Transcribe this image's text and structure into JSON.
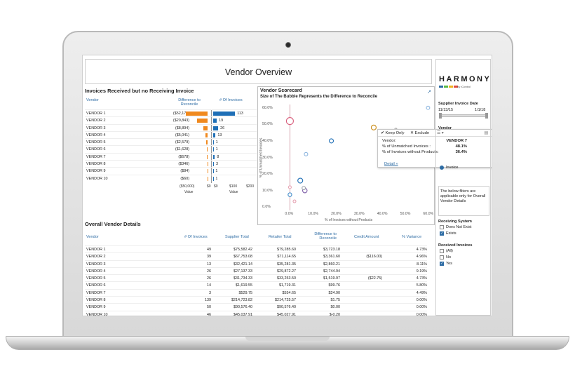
{
  "page_title": "Vendor Overview",
  "invoices": {
    "title": "Invoices Received but no Receiving Invoice",
    "col_vendor": "Vendor",
    "col_diff": "Difference to Reconcile",
    "col_count": "# Of Invoices",
    "rows": [
      {
        "vendor": "VENDOR 1",
        "diff": "($52,178)",
        "count": "113",
        "diff_frac": 0.9,
        "count_frac": 0.92
      },
      {
        "vendor": "VENDOR 2",
        "diff": "($20,843)",
        "count": "19",
        "diff_frac": 0.44,
        "count_frac": 0.15
      },
      {
        "vendor": "VENDOR 3",
        "diff": "($8,894)",
        "count": "26",
        "diff_frac": 0.18,
        "count_frac": 0.21
      },
      {
        "vendor": "VENDOR 4",
        "diff": "($5,041)",
        "count": "13",
        "diff_frac": 0.1,
        "count_frac": 0.1
      },
      {
        "vendor": "VENDOR 5",
        "diff": "($2,579)",
        "count": "1",
        "diff_frac": 0.05,
        "count_frac": 0.02
      },
      {
        "vendor": "VENDOR 6",
        "diff": "($1,628)",
        "count": "1",
        "diff_frac": 0.03,
        "count_frac": 0.02
      },
      {
        "vendor": "VENDOR 7",
        "diff": "($678)",
        "count": "8",
        "diff_frac": 0.02,
        "count_frac": 0.07
      },
      {
        "vendor": "VENDOR 8",
        "diff": "($346)",
        "count": "3",
        "diff_frac": 0.01,
        "count_frac": 0.03
      },
      {
        "vendor": "VENDOR 9",
        "diff": "($84)",
        "count": "1",
        "diff_frac": 0.005,
        "count_frac": 0.01
      },
      {
        "vendor": "VENDOR 10",
        "diff": "($60)",
        "count": "1",
        "diff_frac": 0.005,
        "count_frac": 0.01
      }
    ],
    "axis_diff_ticks": [
      "($50,000)",
      "$0"
    ],
    "axis_count_ticks": [
      "$0",
      "$100",
      "$200"
    ],
    "axis_label": "Value"
  },
  "scorecard": {
    "title": "Vendor Scorecard",
    "subtitle": "Size of The Bubble Represents the Difference to Reconcile"
  },
  "chart_data": {
    "type": "scatter",
    "title": "Vendor Scorecard",
    "subtitle": "Size of The Bubble Represents the Difference to Reconcile",
    "xlabel": "% of Invoices without Products",
    "ylabel": "% of Unmatched Invoices",
    "xlim": [
      -0.05,
      0.62
    ],
    "ylim": [
      -0.02,
      0.62
    ],
    "x_ticks": [
      "0.0%",
      "10.0%",
      "20.0%",
      "30.0%",
      "40.0%",
      "50.0%",
      "60.0%"
    ],
    "y_ticks": [
      "0.0%",
      "10.0%",
      "20.0%",
      "30.0%",
      "40.0%",
      "50.0%",
      "60.0%"
    ],
    "points": [
      {
        "x": 0.0,
        "y": 0.52,
        "size": 5,
        "color": "#d9607e"
      },
      {
        "x": 0.364,
        "y": 0.481,
        "size": 3.5,
        "color": "#c98a14"
      },
      {
        "x": 0.18,
        "y": 0.4,
        "size": 3,
        "color": "#1f6fb6"
      },
      {
        "x": 0.07,
        "y": 0.32,
        "size": 2.5,
        "color": "#8fb7e0"
      },
      {
        "x": 0.045,
        "y": 0.16,
        "size": 3.5,
        "color": "#1f6fb6"
      },
      {
        "x": 0.065,
        "y": 0.1,
        "size": 3.2,
        "color": "#7b5aa6"
      },
      {
        "x": 0.06,
        "y": 0.115,
        "size": 2.4,
        "color": "#9aa0aa"
      },
      {
        "x": 0.0,
        "y": 0.075,
        "size": 2.6,
        "color": "#3a88c8"
      },
      {
        "x": 0.0,
        "y": 0.12,
        "size": 2,
        "color": "#e7a3b3"
      },
      {
        "x": 0.02,
        "y": 0.035,
        "size": 2,
        "color": "#e7a3b3"
      },
      {
        "x": 0.6,
        "y": 0.6,
        "size": 2.4,
        "color": "#8fb7e0"
      },
      {
        "x": 0.46,
        "y": 0.47,
        "size": 1.6,
        "color": "#aaaaaa"
      }
    ]
  },
  "tooltip": {
    "keep_only": "Keep Only",
    "exclude": "Exclude",
    "vendor_label": "Vendor:",
    "vendor_value": "VENDOR 7",
    "unmatched_label": "% of Unmatched Invoices :",
    "unmatched_value": "48.1%",
    "noproducts_label": "% of Invoices without Products:",
    "noproducts_value": "36.4%",
    "detail_link": "Detail »"
  },
  "overall": {
    "title": "Overall Vendor Details",
    "columns": [
      "Vendor",
      "# Of Invoices",
      "Supplier Total",
      "Retailer Total",
      "Difference to Reconcile",
      "Credit Amount",
      "% Variance"
    ],
    "rows": [
      [
        "VENDOR 1",
        "49",
        "$75,582.42",
        "$79,285.60",
        "$3,723.18",
        "",
        "4.73%"
      ],
      [
        "VENDOR 2",
        "39",
        "$67,753.08",
        "$71,114.65",
        "$3,361.60",
        "($116.00)",
        "4.96%"
      ],
      [
        "VENDOR 3",
        "13",
        "$32,421.14",
        "$35,281.35",
        "$2,860.21",
        "",
        "8.11%"
      ],
      [
        "VENDOR 4",
        "26",
        "$27,137.33",
        "$29,872.27",
        "$2,744.94",
        "",
        "9.19%"
      ],
      [
        "VENDOR 5",
        "26",
        "$31,734.33",
        "$33,253.50",
        "$1,519.97",
        "($22.75)",
        "4.73%"
      ],
      [
        "VENDOR 6",
        "14",
        "$1,619.55",
        "$1,719.31",
        "$99.76",
        "",
        "5.80%"
      ],
      [
        "VENDOR 7",
        "3",
        "$529.75",
        "$554.65",
        "$24.90",
        "",
        "4.49%"
      ],
      [
        "VENDOR 8",
        "139",
        "$214,723.82",
        "$214,725.57",
        "$1.75",
        "",
        "0.00%"
      ],
      [
        "VENDOR 9",
        "50",
        "$90,576.40",
        "$90,576.40",
        "$0.00",
        "",
        "0.00%"
      ],
      [
        "VENDOR 10",
        "46",
        "$45,037.91",
        "$45,027.91",
        "$-0.20",
        "",
        "0.00%"
      ]
    ]
  },
  "filters": {
    "logo_text": "HARMONY",
    "logo_by": "by iControl",
    "logo_colors": [
      "#2e6ca4",
      "#58b947",
      "#f0b41e",
      "#e14b3a"
    ],
    "date_label": "Supplier Invoice Date",
    "date_from": "11/13/15",
    "date_to": "1/1/18",
    "vendor_label": "Vendor",
    "invoice_option": "Invoice",
    "note": "The below filters are applicable only for Overall Vendor Details",
    "receiving_label": "Receiving System",
    "receiving_opts": [
      {
        "label": "Does Not Exist",
        "checked": false
      },
      {
        "label": "Exists",
        "checked": true
      }
    ],
    "received_label": "Received Invoices",
    "received_opts": [
      {
        "label": "(All)",
        "checked": false
      },
      {
        "label": "No",
        "checked": false
      },
      {
        "label": "Yes",
        "checked": true
      }
    ]
  }
}
